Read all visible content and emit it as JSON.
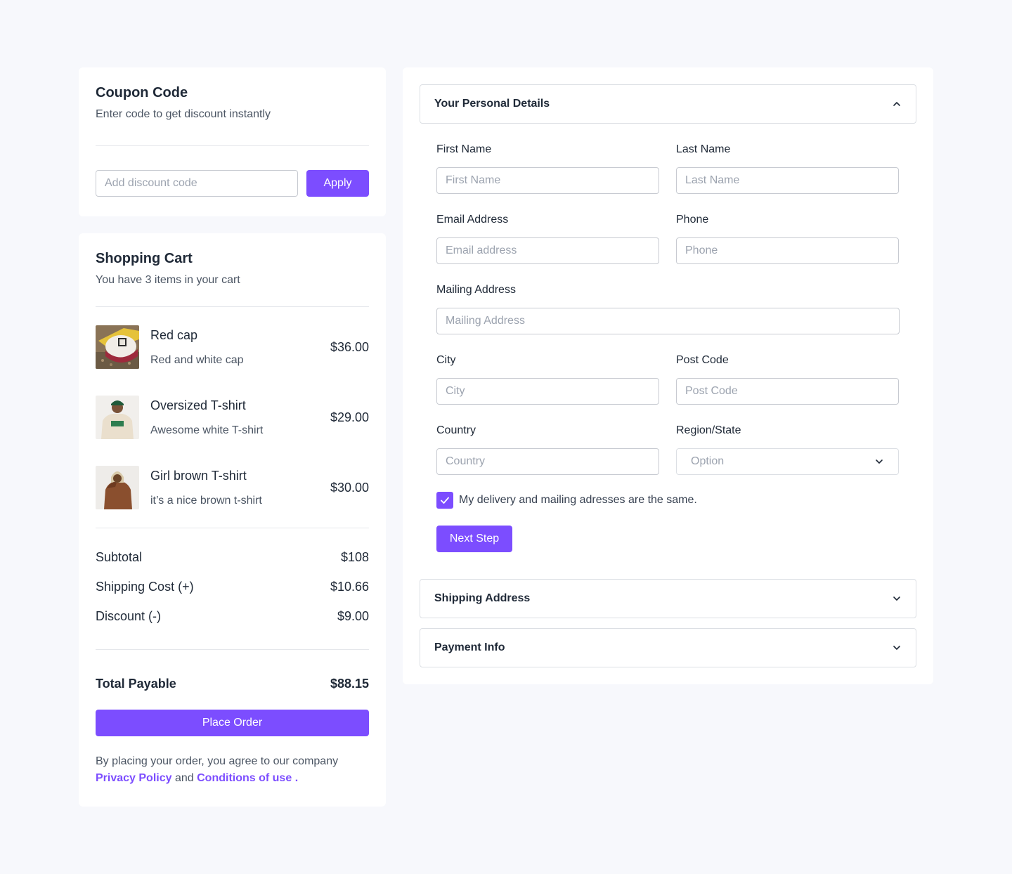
{
  "coupon": {
    "title": "Coupon Code",
    "subtitle": "Enter code to get discount instantly",
    "placeholder": "Add discount code",
    "apply_label": "Apply"
  },
  "cart": {
    "title": "Shopping Cart",
    "subtitle": "You have 3 items in your cart",
    "items": [
      {
        "name": "Red cap",
        "desc": "Red and white cap",
        "price": "$36.00",
        "image": "red-cap-photo"
      },
      {
        "name": "Oversized T-shirt",
        "desc": "Awesome white T-shirt",
        "price": "$29.00",
        "image": "white-tshirt-photo"
      },
      {
        "name": "Girl brown T-shirt",
        "desc": "it’s a nice brown t-shirt",
        "price": "$30.00",
        "image": "brown-tshirt-photo"
      }
    ],
    "summary": [
      {
        "label": "Subtotal",
        "value": "$108"
      },
      {
        "label": "Shipping Cost (+)",
        "value": "$10.66"
      },
      {
        "label": "Discount (-)",
        "value": "$9.00"
      }
    ],
    "total_label": "Total Payable",
    "total_value": "$88.15",
    "place_order_label": "Place Order",
    "agree_text": "By placing your order, you agree to our company",
    "privacy_link": "Privacy Policy",
    "and_text": "and",
    "conditions_link": "Conditions of use",
    "period": "."
  },
  "checkout": {
    "personal": {
      "title": "Your Personal Details",
      "expanded": true,
      "first_name": {
        "label": "First Name",
        "placeholder": "First Name"
      },
      "last_name": {
        "label": "Last Name",
        "placeholder": "Last Name"
      },
      "email": {
        "label": "Email Address",
        "placeholder": "Email address"
      },
      "phone": {
        "label": "Phone",
        "placeholder": "Phone"
      },
      "mailing": {
        "label": "Mailing Address",
        "placeholder": "Mailing Address"
      },
      "city": {
        "label": "City",
        "placeholder": "City"
      },
      "post_code": {
        "label": "Post Code",
        "placeholder": "Post Code"
      },
      "country": {
        "label": "Country",
        "placeholder": "Country"
      },
      "region": {
        "label": "Region/State",
        "value": "Option"
      },
      "same_address": {
        "label": "My delivery and mailing adresses are the same.",
        "checked": true
      },
      "next_label": "Next Step"
    },
    "shipping_title": "Shipping Address",
    "payment_title": "Payment Info"
  },
  "colors": {
    "accent": "#7c4dff",
    "background": "#f7f8fc",
    "card": "#ffffff",
    "border": "#dcdfe4"
  }
}
